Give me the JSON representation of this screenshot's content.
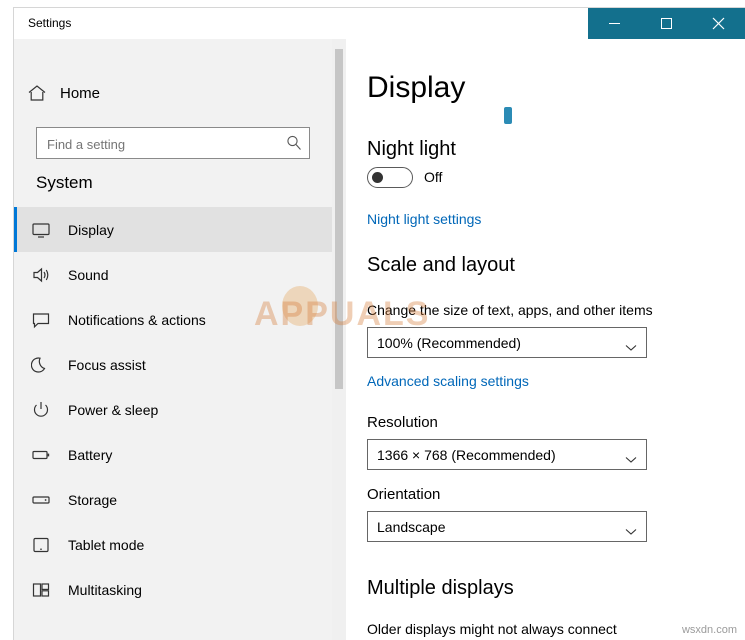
{
  "window": {
    "title": "Settings",
    "caption": {
      "minimize": "minimize-icon",
      "maximize": "maximize-icon",
      "close": "close-icon"
    },
    "caption_color": "#13708d"
  },
  "sidebar": {
    "home_label": "Home",
    "search": {
      "placeholder": "Find a setting",
      "value": "",
      "icon": "search-icon"
    },
    "group_title": "System",
    "items": [
      {
        "label": "Display",
        "icon": "monitor-icon",
        "selected": true
      },
      {
        "label": "Sound",
        "icon": "speaker-icon",
        "selected": false
      },
      {
        "label": "Notifications & actions",
        "icon": "chat-bubble-icon",
        "selected": false
      },
      {
        "label": "Focus assist",
        "icon": "moon-icon",
        "selected": false
      },
      {
        "label": "Power & sleep",
        "icon": "power-icon",
        "selected": false
      },
      {
        "label": "Battery",
        "icon": "battery-icon",
        "selected": false
      },
      {
        "label": "Storage",
        "icon": "storage-icon",
        "selected": false
      },
      {
        "label": "Tablet mode",
        "icon": "tablet-icon",
        "selected": false
      },
      {
        "label": "Multitasking",
        "icon": "multitask-icon",
        "selected": false
      }
    ],
    "accent_color": "#0078d7"
  },
  "content": {
    "page_title": "Display",
    "night_light": {
      "heading": "Night light",
      "toggle_state": "Off",
      "settings_link": "Night light settings"
    },
    "scale_and_layout": {
      "heading": "Scale and layout",
      "size_label": "Change the size of text, apps, and other items",
      "size_value": "100% (Recommended)",
      "advanced_link": "Advanced scaling settings",
      "resolution_label": "Resolution",
      "resolution_value": "1366 × 768 (Recommended)",
      "orientation_label": "Orientation",
      "orientation_value": "Landscape"
    },
    "multiple_displays": {
      "heading": "Multiple displays",
      "note": "Older displays might not always connect"
    },
    "link_color": "#0067b8"
  },
  "watermark": {
    "text": "APPUALS",
    "credit": "wsxdn.com"
  }
}
